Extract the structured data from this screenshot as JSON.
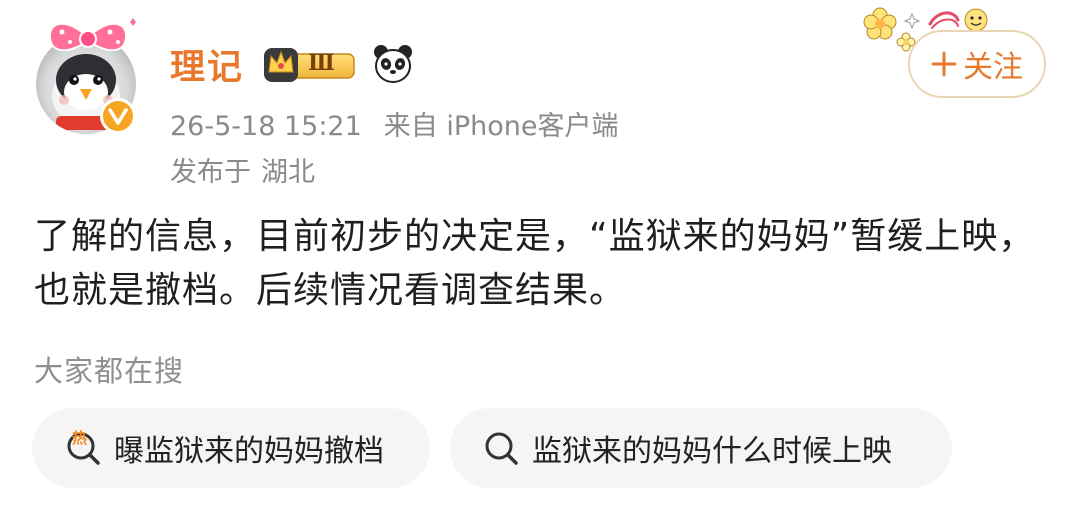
{
  "post": {
    "author": {
      "name": "理记",
      "vip_level": "Ⅲ",
      "badges": [
        "crown-vip-badge",
        "panda-badge"
      ],
      "verified": true,
      "verified_color": "#f7a623"
    },
    "timestamp": "26-5-18 15:21",
    "source": "来自 iPhone客户端",
    "location_label": "发布于",
    "location": "湖北",
    "follow_label": "关注",
    "body": "了解的信息，目前初步的决定是，“监狱来的妈妈”暂缓上映，也就是撤档。后续情况看调查结果。"
  },
  "related_searches": {
    "label": "大家都在搜",
    "items": [
      {
        "icon": "hot-search-icon",
        "hot_mark": "热",
        "text": "曝监狱来的妈妈撤档"
      },
      {
        "icon": "search-icon",
        "text": "监狱来的妈妈什么时候上映"
      }
    ]
  },
  "colors": {
    "accent": "#e8792c",
    "meta_text": "#8a8a8a",
    "chip_bg": "#f5f5f5",
    "follow_border": "#e9d5b2"
  }
}
